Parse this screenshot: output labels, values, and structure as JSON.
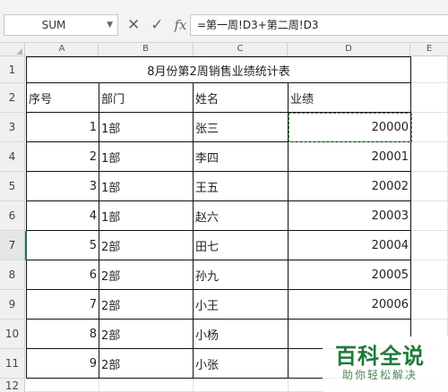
{
  "formula_bar": {
    "name_box": "SUM",
    "cancel_icon": "close-icon",
    "confirm_icon": "check-icon",
    "fx_label": "fx",
    "formula": "=第一周!D3+第二周!D3"
  },
  "columns": [
    "A",
    "B",
    "C",
    "D",
    "E"
  ],
  "rows": [
    "1",
    "2",
    "3",
    "4",
    "5",
    "6",
    "7",
    "8",
    "9",
    "10",
    "11",
    "12"
  ],
  "sheet": {
    "title": "8月份第2周销售业绩统计表",
    "headers": [
      "序号",
      "部门",
      "姓名",
      "业绩"
    ],
    "records": [
      {
        "no": "1",
        "dept": "1部",
        "name": "张三",
        "value": "20000"
      },
      {
        "no": "2",
        "dept": "1部",
        "name": "李四",
        "value": "20001"
      },
      {
        "no": "3",
        "dept": "1部",
        "name": "王五",
        "value": "20002"
      },
      {
        "no": "4",
        "dept": "1部",
        "name": "赵六",
        "value": "20003"
      },
      {
        "no": "5",
        "dept": "2部",
        "name": "田七",
        "value": "20004"
      },
      {
        "no": "6",
        "dept": "2部",
        "name": "孙九",
        "value": "20005"
      },
      {
        "no": "7",
        "dept": "2部",
        "name": "小王",
        "value": "20006"
      },
      {
        "no": "8",
        "dept": "2部",
        "name": "小杨",
        "value": ""
      },
      {
        "no": "9",
        "dept": "2部",
        "name": "小张",
        "value": ""
      }
    ]
  },
  "watermark": {
    "title": "百科全说",
    "subtitle": "助你轻松解决"
  }
}
